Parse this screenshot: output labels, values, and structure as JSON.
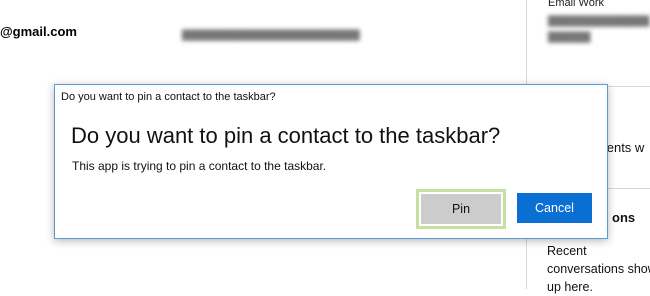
{
  "background": {
    "left_account_suffix": "@gmail.com",
    "right_panel": {
      "email_label": "Email Work",
      "events_text": "events w",
      "section_heading_fragment": "ons",
      "recent_text": "Recent conversations show up here."
    }
  },
  "dialog": {
    "title_bar": "Do you want to pin a contact to the taskbar?",
    "heading": "Do you want to pin a contact to the taskbar?",
    "message": "This app is trying to pin a contact to the taskbar.",
    "pin_label": "Pin",
    "cancel_label": "Cancel"
  },
  "colors": {
    "accent": "#0a6fd2",
    "dialog_border": "#5b9bd5",
    "pin_focus": "#c5e0a0"
  }
}
